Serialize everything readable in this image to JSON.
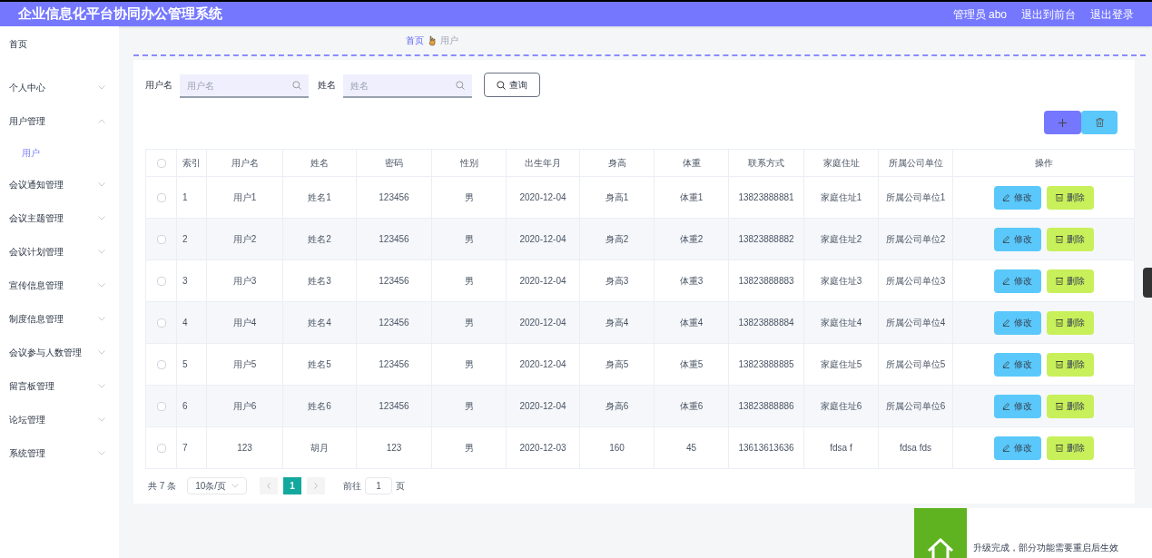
{
  "header": {
    "title": "企业信息化平台协同办公管理系统",
    "links": [
      "管理员 abo",
      "退出到前台",
      "退出登录"
    ]
  },
  "sidebar": {
    "items": [
      {
        "label": "首页",
        "kind": "link",
        "selected": false
      },
      {
        "label": "个人中心",
        "kind": "group",
        "expanded": false,
        "selected": false
      },
      {
        "label": "用户管理",
        "kind": "group",
        "expanded": true,
        "selected": false,
        "children": [
          {
            "label": "用户",
            "kind": "link",
            "selected": true
          }
        ]
      },
      {
        "label": "会议通知管理",
        "kind": "group",
        "expanded": false,
        "selected": false
      },
      {
        "label": "会议主题管理",
        "kind": "group",
        "expanded": false,
        "selected": false
      },
      {
        "label": "会议计划管理",
        "kind": "group",
        "expanded": false,
        "selected": false
      },
      {
        "label": "宣传信息管理",
        "kind": "group",
        "expanded": false,
        "selected": false
      },
      {
        "label": "制度信息管理",
        "kind": "group",
        "expanded": false,
        "selected": false
      },
      {
        "label": "会议参与人数管理",
        "kind": "group",
        "expanded": false,
        "selected": false
      },
      {
        "label": "留言板管理",
        "kind": "group",
        "expanded": false,
        "selected": false
      },
      {
        "label": "论坛管理",
        "kind": "group",
        "expanded": false,
        "selected": false
      },
      {
        "label": "系统管理",
        "kind": "group",
        "expanded": false,
        "selected": false
      }
    ]
  },
  "breadcrumb": [
    "首页",
    "用户"
  ],
  "search": {
    "fields": [
      {
        "label": "用户名",
        "placeholder": "用户名"
      },
      {
        "label": "姓名",
        "placeholder": "姓名"
      }
    ],
    "button": "查询"
  },
  "table": {
    "all_checked": false,
    "columns": [
      "索引",
      "用户名",
      "姓名",
      "密码",
      "性别",
      "出生年月",
      "身高",
      "体重",
      "联系方式",
      "家庭住址",
      "所属公司单位",
      "操作"
    ],
    "rows": [
      {
        "checked": false,
        "cells": [
          "1",
          "用户1",
          "姓名1",
          "123456",
          "男",
          "2020-12-04",
          "身高1",
          "体重1",
          "13823888881",
          "家庭住址1",
          "所属公司单位1"
        ],
        "actions": [
          "修改",
          "删除"
        ]
      },
      {
        "checked": false,
        "cells": [
          "2",
          "用户2",
          "姓名2",
          "123456",
          "男",
          "2020-12-04",
          "身高2",
          "体重2",
          "13823888882",
          "家庭住址2",
          "所属公司单位2"
        ],
        "actions": [
          "修改",
          "删除"
        ]
      },
      {
        "checked": false,
        "cells": [
          "3",
          "用户3",
          "姓名3",
          "123456",
          "男",
          "2020-12-04",
          "身高3",
          "体重3",
          "13823888883",
          "家庭住址3",
          "所属公司单位3"
        ],
        "actions": [
          "修改",
          "删除"
        ]
      },
      {
        "checked": false,
        "cells": [
          "4",
          "用户4",
          "姓名4",
          "123456",
          "男",
          "2020-12-04",
          "身高4",
          "体重4",
          "13823888884",
          "家庭住址4",
          "所属公司单位4"
        ],
        "actions": [
          "修改",
          "删除"
        ]
      },
      {
        "checked": false,
        "cells": [
          "5",
          "用户5",
          "姓名5",
          "123456",
          "男",
          "2020-12-04",
          "身高5",
          "体重5",
          "13823888885",
          "家庭住址5",
          "所属公司单位5"
        ],
        "actions": [
          "修改",
          "删除"
        ]
      },
      {
        "checked": false,
        "cells": [
          "6",
          "用户6",
          "姓名6",
          "123456",
          "男",
          "2020-12-04",
          "身高6",
          "体重6",
          "13823888886",
          "家庭住址6",
          "所属公司单位6"
        ],
        "actions": [
          "修改",
          "删除"
        ]
      },
      {
        "checked": false,
        "cells": [
          "7",
          "123",
          "胡月",
          "123",
          "男",
          "2020-12-03",
          "160",
          "45",
          "13613613636",
          "fdsa f",
          "fdsa fds"
        ],
        "actions": [
          "修改",
          "删除"
        ]
      }
    ]
  },
  "pagination": {
    "total": "共 7 条",
    "page_size": "10条/页",
    "pages": [
      {
        "label": "1",
        "selected": true
      }
    ],
    "goto_label": "前往",
    "goto_value": "1",
    "goto_suffix": "页"
  },
  "notification": {
    "text": "升级完成，部分功能需要重启后生效"
  }
}
